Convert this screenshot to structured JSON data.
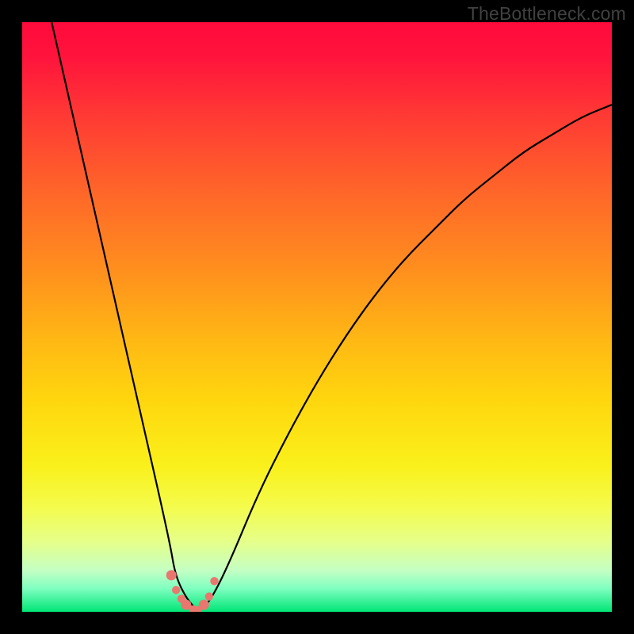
{
  "watermark": "TheBottleneck.com",
  "chart_data": {
    "type": "line",
    "title": "",
    "xlabel": "",
    "ylabel": "",
    "xlim": [
      0,
      100
    ],
    "ylim": [
      0,
      100
    ],
    "grid": false,
    "series": [
      {
        "name": "bottleneck-curve",
        "x": [
          5,
          10,
          15,
          20,
          25,
          26,
          28,
          30,
          32,
          35,
          40,
          45,
          50,
          55,
          60,
          65,
          70,
          75,
          80,
          85,
          90,
          95,
          100
        ],
        "y": [
          100,
          78,
          56,
          34,
          12,
          6,
          2,
          0,
          2,
          8,
          20,
          30,
          39,
          47,
          54,
          60,
          65,
          70,
          74,
          78,
          81,
          84,
          86
        ]
      }
    ],
    "markers": {
      "name": "highlight-points",
      "color": "#e9776f",
      "x": [
        25.3,
        26.1,
        27.0,
        27.8,
        29.0,
        29.8,
        30.8,
        31.7,
        32.6
      ],
      "y": [
        6.2,
        3.7,
        2.2,
        1.2,
        0.4,
        0.3,
        1.2,
        2.6,
        5.2
      ]
    },
    "background": {
      "type": "vertical-gradient",
      "stops": [
        {
          "pos": 0.0,
          "color": "#ff0a3c"
        },
        {
          "pos": 0.2,
          "color": "#ff5030"
        },
        {
          "pos": 0.45,
          "color": "#ffa518"
        },
        {
          "pos": 0.7,
          "color": "#fde818"
        },
        {
          "pos": 0.9,
          "color": "#dcff94"
        },
        {
          "pos": 1.0,
          "color": "#00e676"
        }
      ]
    }
  }
}
